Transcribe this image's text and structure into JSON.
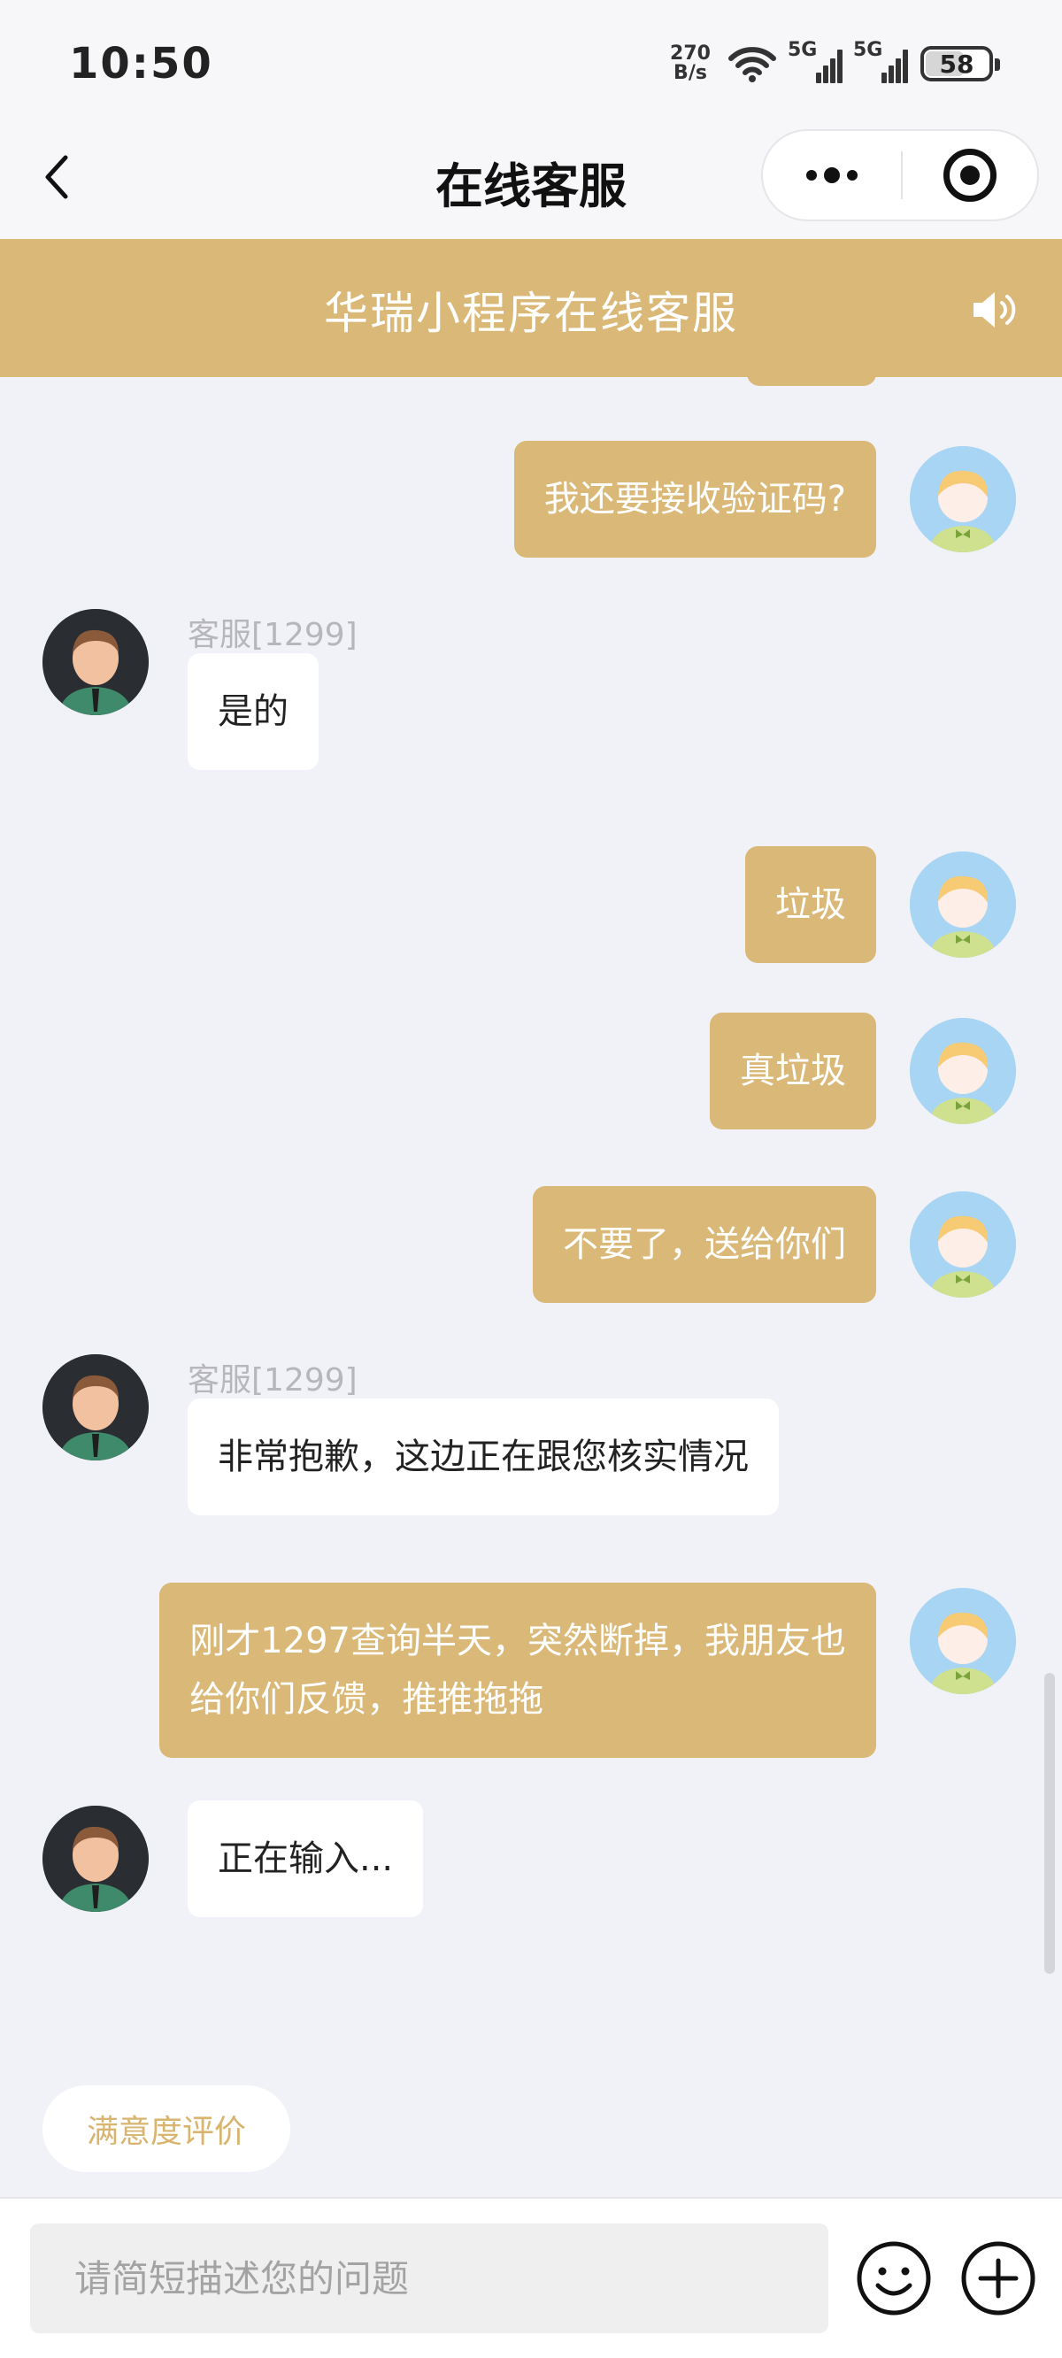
{
  "status_bar": {
    "time": "10:50",
    "net_speed_value": "270",
    "net_speed_unit": "B/s",
    "signal_1_label": "5G",
    "signal_2_label": "5G",
    "battery": "58"
  },
  "nav": {
    "title": "在线客服"
  },
  "banner": {
    "title": "华瑞小程序在线客服"
  },
  "messages": [
    {
      "from": "user",
      "text": "我还要接收验证码?"
    },
    {
      "from": "agent",
      "name": "客服[1299]",
      "text": "是的"
    },
    {
      "from": "user",
      "text": "垃圾"
    },
    {
      "from": "user",
      "text": "真垃圾"
    },
    {
      "from": "user",
      "text": "不要了，送给你们"
    },
    {
      "from": "agent",
      "name": "客服[1299]",
      "text": "非常抱歉，这边正在跟您核实情况"
    },
    {
      "from": "user",
      "text_line1": "刚才1297查询半天，突然断掉，我朋友也",
      "text_line2": "给你们反馈，推推拖拖"
    },
    {
      "from": "agent",
      "text": "正在输入..."
    }
  ],
  "rating_button": "满意度评价",
  "input": {
    "placeholder": "请简短描述您的问题"
  },
  "icons": {
    "back": "chevron-left-icon",
    "more": "more-dots-icon",
    "close": "target-close-icon",
    "speaker": "speaker-icon",
    "emoji": "emoji-icon",
    "plus": "plus-icon"
  },
  "colors": {
    "accent": "#dab877",
    "background": "#f1f2f8",
    "agent_bubble": "#ffffff",
    "rating_text": "#d8b46e"
  }
}
